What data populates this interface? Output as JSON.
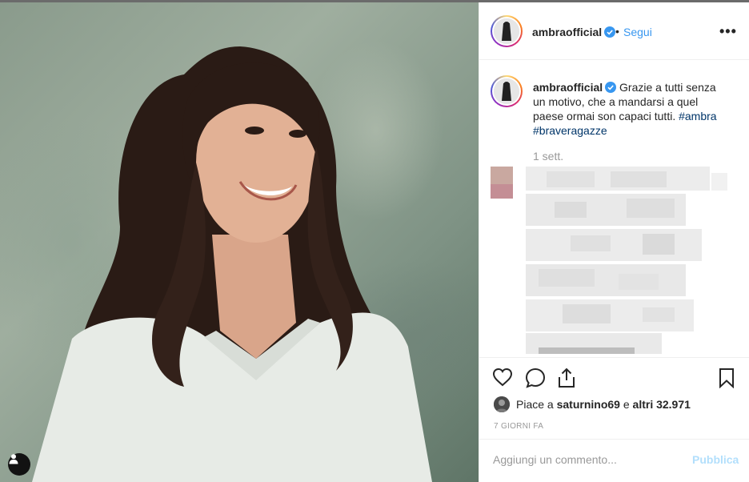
{
  "post": {
    "username": "ambraofficial",
    "follow_label": "Segui",
    "separator": "•",
    "more_label": "•••",
    "caption_text": "Grazie a tutti senza un motivo, che a mandarsi a quel paese ormai son capaci tutti.",
    "hashtags": [
      "#ambra",
      "#braveragazze"
    ],
    "time_ago": "1 sett.",
    "liked_by_prefix": "Piace a",
    "liked_by_user": "saturnino69",
    "likes_conjunction": "e",
    "likes_count_text": "altri 32.971",
    "date_label": "7 GIORNI FA"
  },
  "comment_box": {
    "placeholder": "Aggiungi un commento...",
    "publish_label": "Pubblica"
  },
  "colors": {
    "link_blue": "#3897f0",
    "hashtag_blue": "#003569",
    "publish_disabled": "#b2dffc",
    "verified_blue": "#3897f0",
    "border": "#efefef"
  },
  "icons": [
    "user-tag-icon",
    "verified-icon",
    "heart-icon",
    "comment-icon",
    "share-icon",
    "bookmark-icon",
    "more-options-icon"
  ]
}
